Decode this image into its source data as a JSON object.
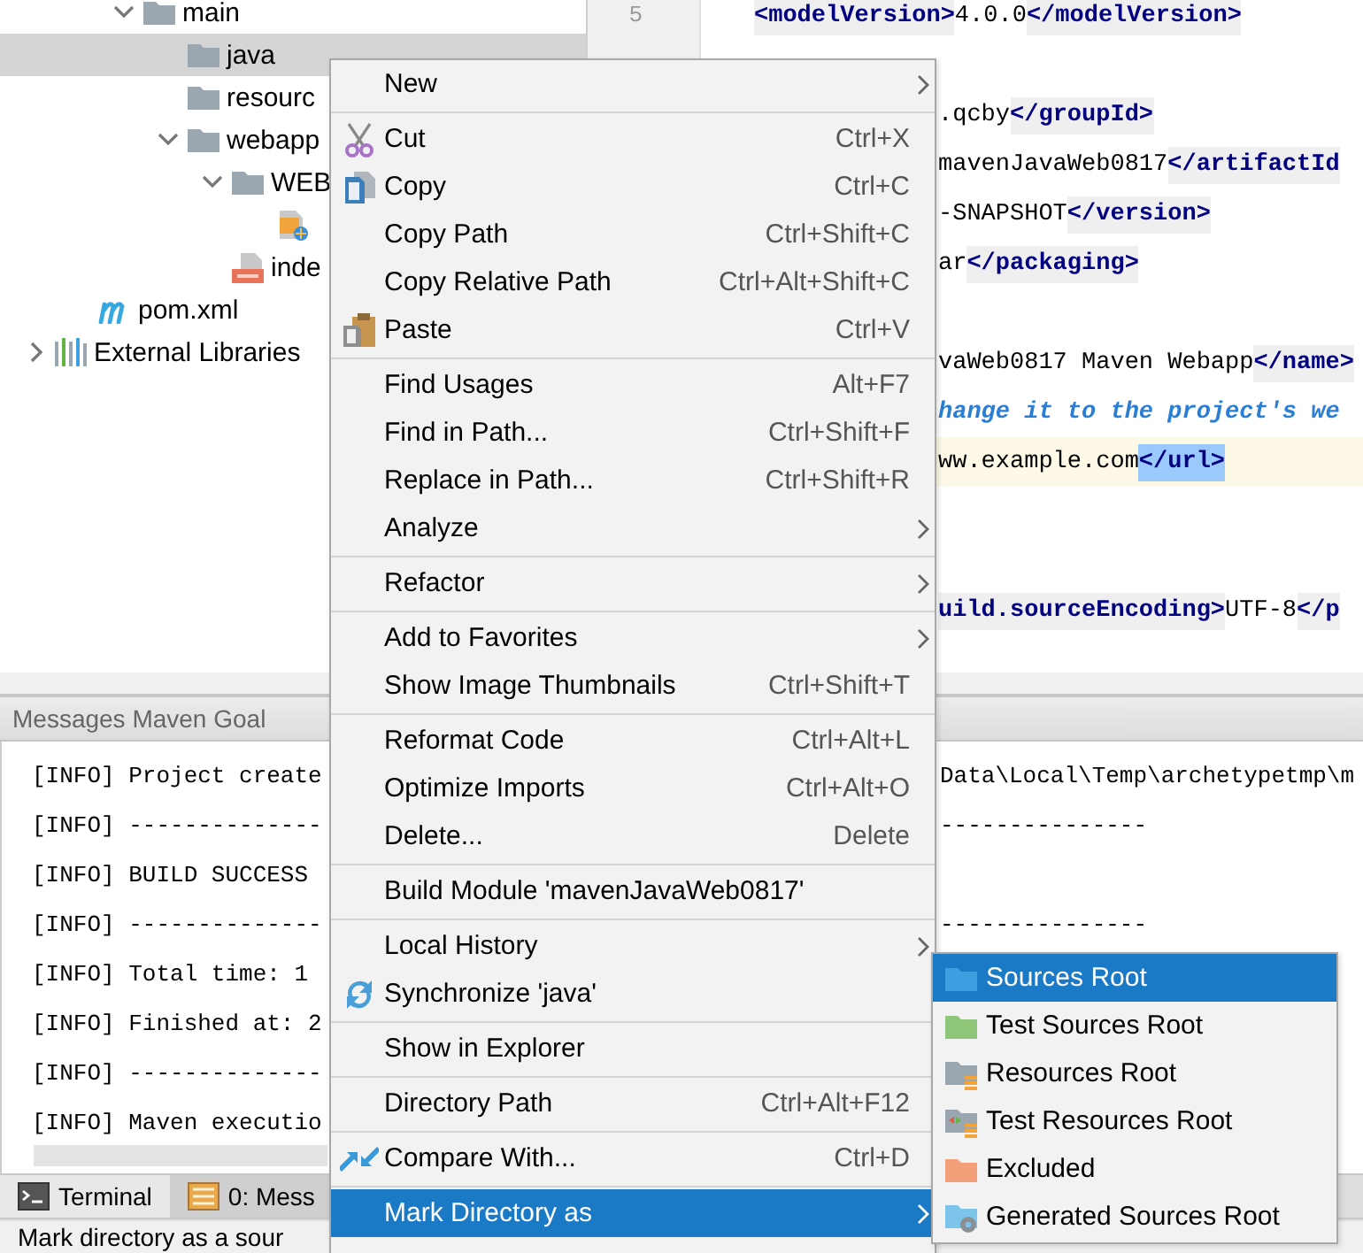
{
  "project_tree": [
    {
      "label": "main",
      "kind": "folder",
      "expanded": true,
      "selected": false,
      "children": [
        {
          "label": "java",
          "kind": "folder",
          "selected": true
        },
        {
          "label": "resourc",
          "kind": "folder",
          "selected": false
        },
        {
          "label": "webapp",
          "kind": "folder",
          "expanded": true,
          "selected": false,
          "children": [
            {
              "label": "WEB",
              "kind": "folder",
              "expanded": true,
              "selected": false,
              "children": [
                {
                  "kind": "webxml",
                  "selected": false
                }
              ]
            },
            {
              "label": "inde",
              "kind": "jsp",
              "selected": false
            }
          ]
        }
      ]
    },
    {
      "label": "pom.xml",
      "kind": "maven",
      "selected": false
    },
    {
      "label": "External Libraries",
      "kind": "library",
      "expanded": false,
      "selected": false
    }
  ],
  "editor": {
    "line_numbers": [
      "5"
    ],
    "lines": [
      {
        "kind": "full",
        "current": false,
        "tokens": [
          {
            "kind": "tag",
            "text": "<modelVersion>"
          },
          {
            "kind": "text",
            "text": "4.0.0"
          },
          {
            "kind": "tag",
            "text": "</modelVersion>"
          }
        ]
      },
      {
        "kind": "blank"
      },
      {
        "kind": "partial",
        "current": false,
        "tokens": [
          {
            "kind": "text",
            "text": ".qcby"
          },
          {
            "kind": "tag",
            "text": "</groupId>"
          }
        ]
      },
      {
        "kind": "partial",
        "current": false,
        "tokens": [
          {
            "kind": "text",
            "text": "mavenJavaWeb0817"
          },
          {
            "kind": "tag",
            "text": "</artifactId"
          }
        ]
      },
      {
        "kind": "partial",
        "current": false,
        "tokens": [
          {
            "kind": "text",
            "text": "-SNAPSHOT"
          },
          {
            "kind": "tag",
            "text": "</version>"
          }
        ]
      },
      {
        "kind": "partial",
        "current": false,
        "tokens": [
          {
            "kind": "text",
            "text": "ar"
          },
          {
            "kind": "tag",
            "text": "</packaging>"
          }
        ]
      },
      {
        "kind": "blank"
      },
      {
        "kind": "partial",
        "current": false,
        "tokens": [
          {
            "kind": "text",
            "text": "vaWeb0817 Maven Webapp"
          },
          {
            "kind": "tag",
            "text": "</name>"
          }
        ]
      },
      {
        "kind": "partial",
        "current": false,
        "tokens": [
          {
            "kind": "comment",
            "text": "hange it to the project's we"
          }
        ]
      },
      {
        "kind": "partial",
        "current": true,
        "tokens": [
          {
            "kind": "text",
            "text": "ww.example.com"
          },
          {
            "kind": "selected",
            "text": "</url>"
          }
        ]
      },
      {
        "kind": "blank"
      },
      {
        "kind": "blank"
      },
      {
        "kind": "partial",
        "current": false,
        "tokens": [
          {
            "kind": "tag",
            "text": "uild.sourceEncoding>"
          },
          {
            "kind": "text",
            "text": "UTF-8"
          },
          {
            "kind": "tag",
            "text": "</p"
          }
        ]
      }
    ]
  },
  "messages": {
    "title": "Messages Maven Goal",
    "lines": [
      {
        "left": "[INFO] Project create",
        "right": "Data\\Local\\Temp\\archetypetmp\\m"
      },
      {
        "left": "[INFO] --------------",
        "right": "---------------"
      },
      {
        "left": "[INFO] BUILD SUCCESS"
      },
      {
        "left": "[INFO] --------------",
        "right": "---------------"
      },
      {
        "left": "[INFO] Total time:  1"
      },
      {
        "left": "[INFO] Finished at: 2"
      },
      {
        "left": "[INFO] --------------"
      },
      {
        "left": "[INFO] Maven executio"
      }
    ]
  },
  "tool_tabs": [
    {
      "label": "Terminal",
      "kind": "terminal",
      "selected": false
    },
    {
      "label": "0: Mess",
      "kind": "messages",
      "selected": true
    }
  ],
  "status_bar": {
    "text": "Mark directory as a sour"
  },
  "context_menu": [
    {
      "kind": "item",
      "label": "New",
      "submenu": true,
      "selected": false
    },
    {
      "kind": "separator"
    },
    {
      "kind": "scissors",
      "label": "Cut",
      "shortcut": "Ctrl+X",
      "submenu": false,
      "selected": false
    },
    {
      "kind": "copy",
      "label": "Copy",
      "shortcut": "Ctrl+C",
      "submenu": false,
      "selected": false
    },
    {
      "kind": "item",
      "label": "Copy Path",
      "shortcut": "Ctrl+Shift+C",
      "submenu": false,
      "selected": false
    },
    {
      "kind": "item",
      "label": "Copy Relative Path",
      "shortcut": "Ctrl+Alt+Shift+C",
      "submenu": false,
      "selected": false
    },
    {
      "kind": "paste",
      "label": "Paste",
      "shortcut": "Ctrl+V",
      "submenu": false,
      "selected": false
    },
    {
      "kind": "separator"
    },
    {
      "kind": "item",
      "label": "Find Usages",
      "shortcut": "Alt+F7",
      "submenu": false,
      "selected": false
    },
    {
      "kind": "item",
      "label": "Find in Path...",
      "shortcut": "Ctrl+Shift+F",
      "submenu": false,
      "selected": false
    },
    {
      "kind": "item",
      "label": "Replace in Path...",
      "shortcut": "Ctrl+Shift+R",
      "submenu": false,
      "selected": false
    },
    {
      "kind": "item",
      "label": "Analyze",
      "submenu": true,
      "selected": false
    },
    {
      "kind": "separator"
    },
    {
      "kind": "item",
      "label": "Refactor",
      "submenu": true,
      "selected": false
    },
    {
      "kind": "separator"
    },
    {
      "kind": "item",
      "label": "Add to Favorites",
      "submenu": true,
      "selected": false
    },
    {
      "kind": "item",
      "label": "Show Image Thumbnails",
      "shortcut": "Ctrl+Shift+T",
      "submenu": false,
      "selected": false
    },
    {
      "kind": "separator"
    },
    {
      "kind": "item",
      "label": "Reformat Code",
      "shortcut": "Ctrl+Alt+L",
      "submenu": false,
      "selected": false
    },
    {
      "kind": "item",
      "label": "Optimize Imports",
      "shortcut": "Ctrl+Alt+O",
      "submenu": false,
      "selected": false
    },
    {
      "kind": "item",
      "label": "Delete...",
      "shortcut": "Delete",
      "submenu": false,
      "selected": false
    },
    {
      "kind": "separator"
    },
    {
      "kind": "item",
      "label": "Build Module 'mavenJavaWeb0817'",
      "submenu": false,
      "selected": false
    },
    {
      "kind": "separator"
    },
    {
      "kind": "item",
      "label": "Local History",
      "submenu": true,
      "selected": false
    },
    {
      "kind": "sync",
      "label": "Synchronize 'java'",
      "submenu": false,
      "selected": false
    },
    {
      "kind": "separator"
    },
    {
      "kind": "item",
      "label": "Show in Explorer",
      "submenu": false,
      "selected": false
    },
    {
      "kind": "separator"
    },
    {
      "kind": "item",
      "label": "Directory Path",
      "shortcut": "Ctrl+Alt+F12",
      "submenu": false,
      "selected": false
    },
    {
      "kind": "separator"
    },
    {
      "kind": "compare",
      "label": "Compare With...",
      "shortcut": "Ctrl+D",
      "submenu": false,
      "selected": false
    },
    {
      "kind": "separator"
    },
    {
      "kind": "item",
      "label": "Mark Directory as",
      "submenu": true,
      "selected": true
    }
  ],
  "submenu": [
    {
      "label": "Sources Root",
      "kind": "sources",
      "selected": true
    },
    {
      "label": "Test Sources Root",
      "kind": "testsources",
      "selected": false
    },
    {
      "label": "Resources Root",
      "kind": "resources",
      "selected": false
    },
    {
      "label": "Test Resources Root",
      "kind": "testresources",
      "selected": false
    },
    {
      "label": "Excluded",
      "kind": "excluded",
      "selected": false
    },
    {
      "label": "Generated Sources Root",
      "kind": "generated",
      "selected": false
    }
  ]
}
